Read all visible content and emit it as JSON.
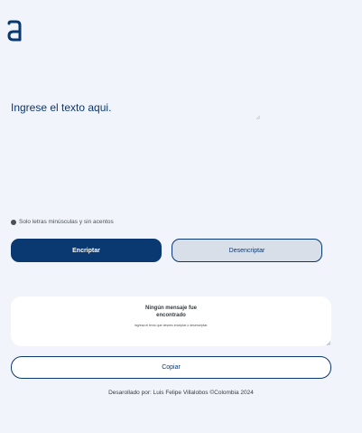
{
  "brand": {
    "logo_icon": "alura-a-logo"
  },
  "editor": {
    "placeholder": "Ingrese el texto aqui."
  },
  "hint": {
    "icon": "info-dot-icon",
    "text": "Solo letras minúsculas y sin acentos"
  },
  "actions": {
    "encrypt_label": "Encriptar",
    "decrypt_label": "Desencriptar",
    "copy_label": "Copiar"
  },
  "result": {
    "title": "Ningún mensaje fue encontrado",
    "text": "Ingresa el texto que desees encriptar o desencriptar."
  },
  "footer": {
    "text": "Desarollado por: Luis Felipe Villalobos ©Colombia 2024"
  },
  "colors": {
    "background": "#f2f4fb",
    "primary": "#0a3871",
    "secondary_bg": "#d8dfe8",
    "card": "#ffffff"
  }
}
